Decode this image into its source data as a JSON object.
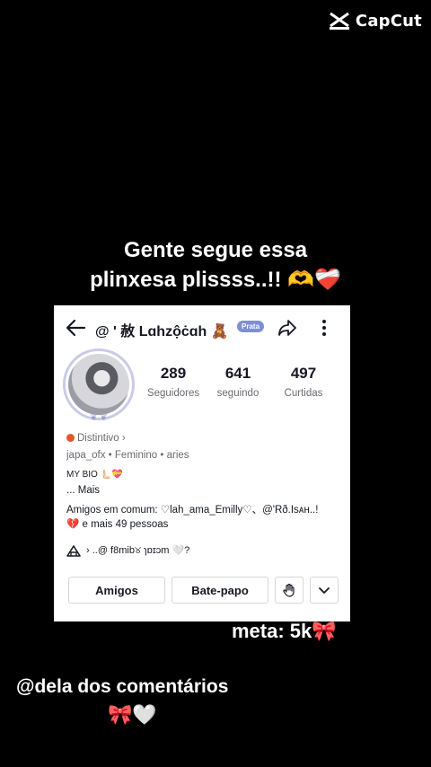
{
  "watermark": {
    "brand": "CapCut"
  },
  "caption_top": {
    "line1": "Gente segue essa",
    "line2": "plinxesa plissss..!! 🫶❤️‍🩹"
  },
  "caption_meta": "meta: 5k🎀",
  "caption_dela": "@dela dos comentários",
  "caption_bows": "🎀🤍",
  "profile": {
    "username": "@ ' 赦 Lɑhzộċɑh 🧸",
    "badge": "Prata",
    "stats": [
      {
        "value": "289",
        "label": "Seguidores"
      },
      {
        "value": "641",
        "label": "seguindo"
      },
      {
        "value": "497",
        "label": "Curtidas"
      }
    ],
    "distintivo": "Distintivo ›",
    "meta_line": "japa_ofx  •  Feminino  •  aries",
    "bio": "MY BIO 🫷🏻💝",
    "mais": "... Mais",
    "amigos_line1": "Amigos em comum: ♡lah_ama_Emilly♡、@'Rð.Isᴀʜ..!",
    "amigos_line2": "💔 e mais 49 pessoas",
    "familia": "› ..@ f8mib୪ ɿɒɪɔm 🤍?",
    "buttons": {
      "amigos": "Amigos",
      "bate_papo": "Bate-papo"
    }
  },
  "icons": {
    "back": "back-arrow-icon",
    "share": "share-icon",
    "more": "more-icon",
    "family": "family-icon",
    "wave": "wave-hand-icon",
    "chevron": "chevron-down-icon"
  }
}
